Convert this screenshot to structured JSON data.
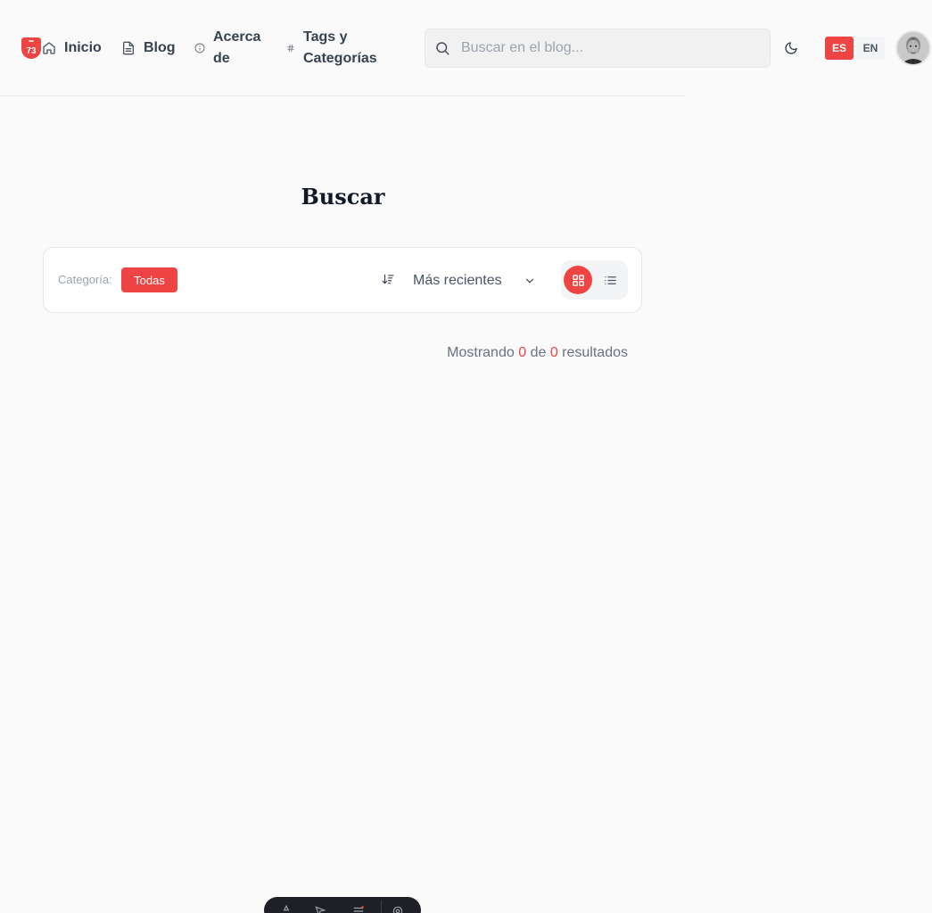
{
  "header": {
    "logo_text": "73",
    "nav": {
      "home": "Inicio",
      "blog": "Blog",
      "about": "Acerca de",
      "tags": "Tags y Categorías"
    },
    "search": {
      "placeholder": "Buscar en el blog...",
      "value": ""
    },
    "languages": {
      "active": "ES",
      "other": "EN"
    }
  },
  "main": {
    "title": "Buscar",
    "filter": {
      "category_label": "Categoría:",
      "category_selected": "Todas",
      "sort_selected": "Más recientes"
    },
    "results": {
      "prefix": "Mostrando",
      "shown": "0",
      "mid": "de",
      "total": "0",
      "suffix": "resultados"
    }
  },
  "colors": {
    "accent": "#ef4444",
    "background": "#fafafa",
    "text": "#374151"
  }
}
